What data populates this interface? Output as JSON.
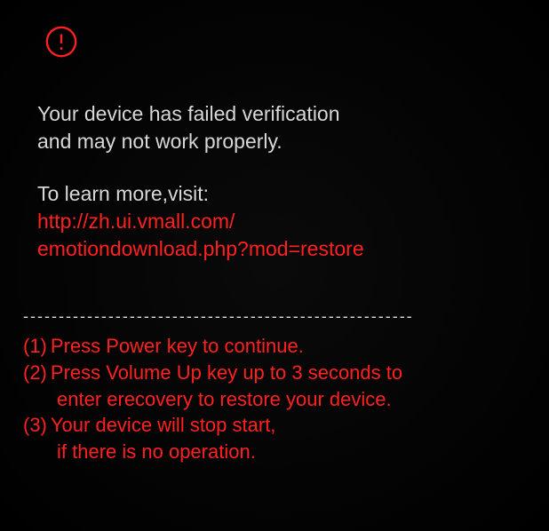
{
  "colors": {
    "error_red": "#ff2020",
    "text_white": "#d8d8d8",
    "background": "#000000"
  },
  "warning": {
    "line1": "Your device has failed verification",
    "line2": "and may not work properly."
  },
  "learn_more": {
    "label": "To learn more,visit:",
    "url_line1": "http://zh.ui.vmall.com/",
    "url_line2": "emotiondownload.php?mod=restore"
  },
  "separator": "-------------------------------------------------------",
  "instructions": [
    {
      "num": "(1)",
      "text": "Press Power key to continue.",
      "continuation": ""
    },
    {
      "num": "(2)",
      "text": "Press Volume Up key up to 3 seconds to",
      "continuation": "enter erecovery to restore your device."
    },
    {
      "num": "(3)",
      "text": "Your device will stop start,",
      "continuation": "if there is no operation."
    }
  ]
}
